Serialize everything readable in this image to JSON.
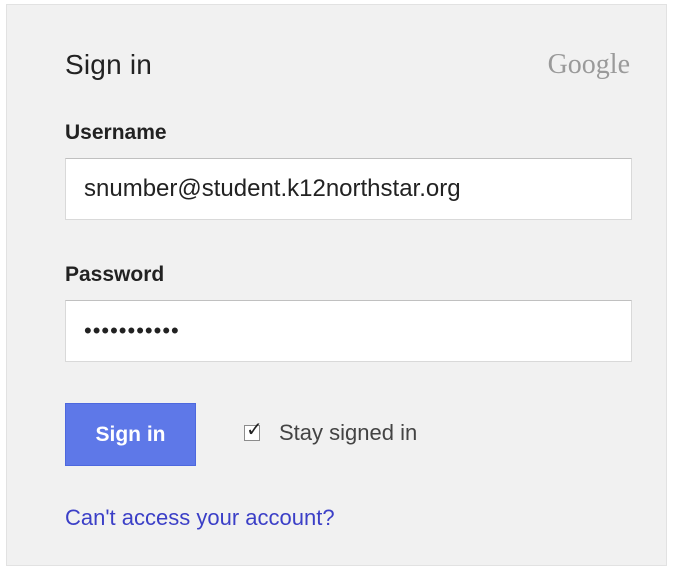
{
  "form": {
    "title": "Sign in",
    "brand": "Google",
    "username_label": "Username",
    "username_value": "snumber@student.k12northstar.org",
    "password_label": "Password",
    "password_value": "•••••••••••",
    "signin_button": "Sign in",
    "stay_signed_in_label": "Stay signed in",
    "stay_signed_in_checked": true,
    "help_link": "Can't access your account?"
  },
  "colors": {
    "button": "#5e78e8",
    "link": "#3b3fc7",
    "card_background": "#f1f1f1"
  },
  "icons": {
    "checkbox": "checkmark-icon"
  }
}
